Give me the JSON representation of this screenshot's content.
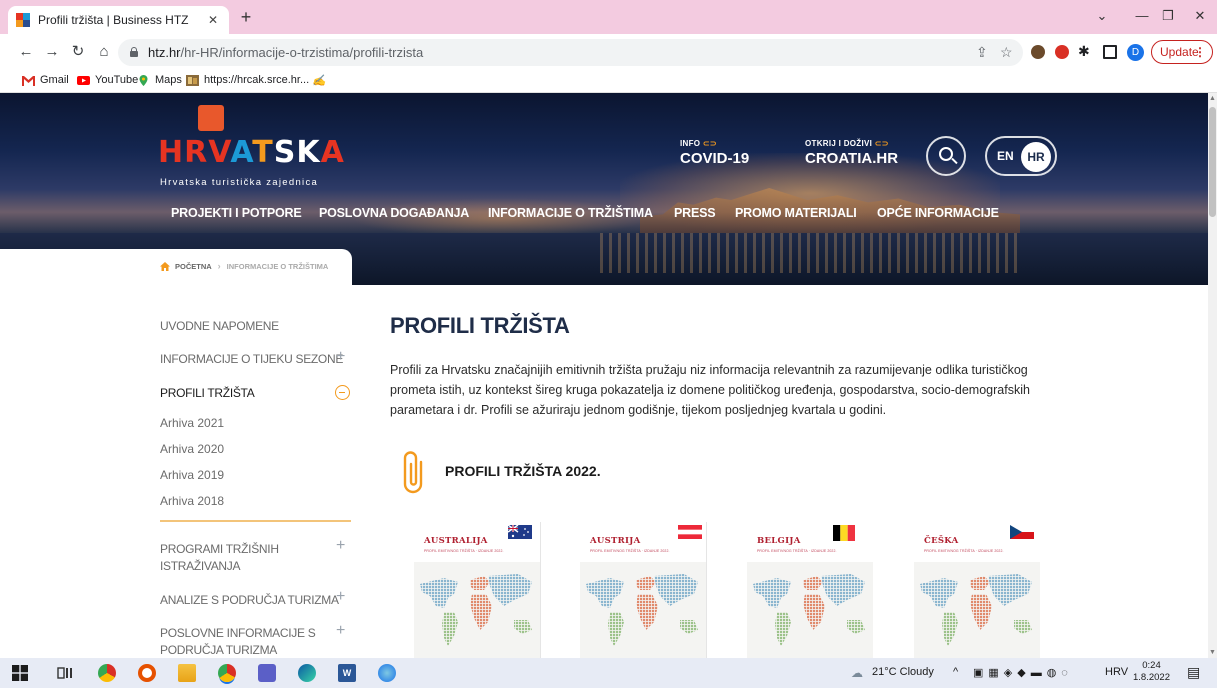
{
  "browser": {
    "tab_title": "Profili tržišta | Business HTZ",
    "url_host": "htz.hr",
    "url_path": "/hr-HR/informacije-o-trzistima/profili-trzista",
    "profile_initial": "D",
    "update_label": "Update",
    "bookmarks": [
      "Gmail",
      "YouTube",
      "Maps",
      "https://hrcak.srce.hr..."
    ]
  },
  "header": {
    "logo_letters": [
      "HRV",
      "A",
      "T",
      "SK",
      "A"
    ],
    "logo_subtitle": "Hrvatska turistička zajednica",
    "quick1_small": "INFO",
    "quick1_big": "COVID-19",
    "quick2_small": "OTKRIJ I DOŽIVI",
    "quick2_big": "CROATIA.HR",
    "lang_en": "EN",
    "lang_hr": "HR",
    "nav": [
      "PROJEKTI I POTPORE",
      "POSLOVNA DOGAĐANJA",
      "INFORMACIJE O TRŽIŠTIMA",
      "PRESS",
      "PROMO MATERIJALI",
      "OPĆE INFORMACIJE"
    ]
  },
  "breadcrumb": {
    "home": "POČETNA",
    "current": "INFORMACIJE O TRŽIŠTIMA"
  },
  "sidebar": {
    "items": [
      {
        "label": "UVODNE NAPOMENE"
      },
      {
        "label": "INFORMACIJE O TIJEKU SEZONE"
      },
      {
        "label": "PROFILI TRŽIŠTA"
      },
      {
        "label": "PROGRAMI TRŽIŠNIH"
      },
      {
        "label": "ISTRAŽIVANJA"
      },
      {
        "label": "ANALIZE S PODRUČJA TURIZMA"
      },
      {
        "label": "POSLOVNE INFORMACIJE S"
      },
      {
        "label": "PODRUČJA TURIZMA"
      }
    ],
    "archives": [
      "Arhiva 2021",
      "Arhiva 2020",
      "Arhiva 2019",
      "Arhiva 2018"
    ]
  },
  "main": {
    "title": "PROFILI TRŽIŠTA",
    "intro": "Profili za Hrvatsku značajnijih emitivnih tržišta pružaju niz informacija relevantnih za razumijevanje odlika turističkog prometa istih, uz kontekst šireg kruga pokazatelja iz domene političkog uređenja, gospodarstva, socio-demografskih parametara i dr. Profili se ažuriraju jednom godišnje, tijekom posljednjeg kvartala u godini.",
    "section_title": "PROFILI TRŽIŠTA 2022.",
    "cards": [
      {
        "name": "AUSTRALIJA",
        "subtitle": "PROFIL EMITIVNOG TRŽIŠTA · IZDANJE 2022."
      },
      {
        "name": "AUSTRIJA",
        "subtitle": "PROFIL EMITIVNOG TRŽIŠTA · IZDANJE 2022."
      },
      {
        "name": "BELGIJA",
        "subtitle": "PROFIL EMITIVNOG TRŽIŠTA · IZDANJE 2022."
      },
      {
        "name": "ČEŠKA",
        "subtitle": "PROFIL EMITIVNOG TRŽIŠTA · IZDANJE 2022."
      }
    ]
  },
  "taskbar": {
    "weather": "21°C Cloudy",
    "lang": "HRV",
    "time": "0:24",
    "date": "1.8.2022"
  },
  "colors": {
    "accent_orange": "#f39a1e",
    "title_navy": "#1f2d48",
    "tab_strip": "#f3cbe0"
  }
}
